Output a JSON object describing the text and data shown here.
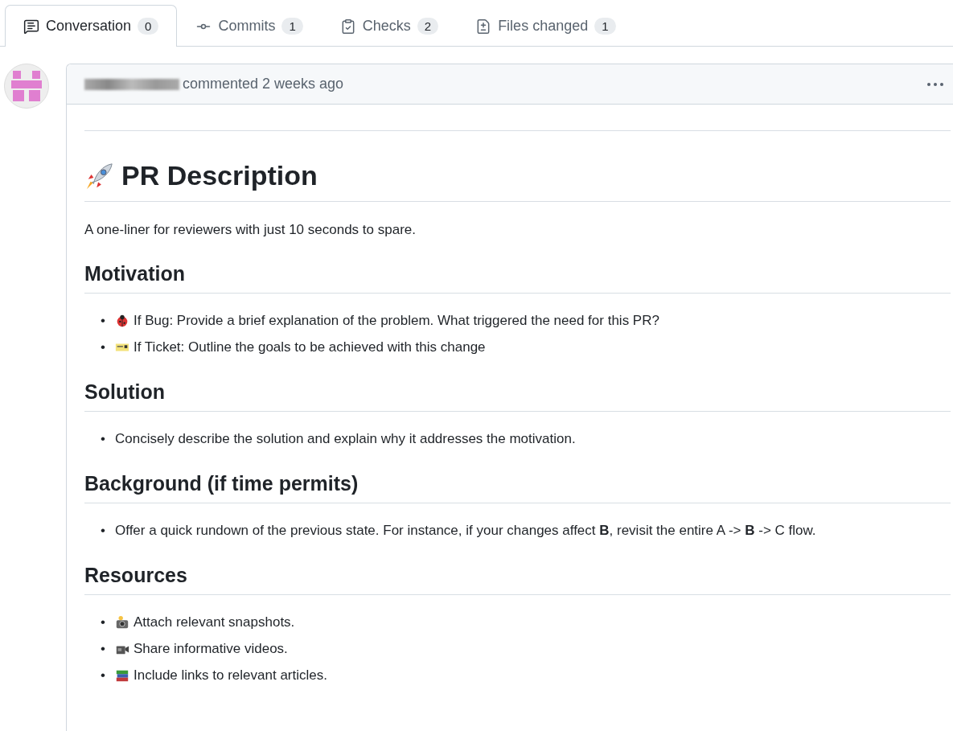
{
  "tabs": [
    {
      "label": "Conversation",
      "count": "0",
      "selected": true,
      "kind": "conversation"
    },
    {
      "label": "Commits",
      "count": "1",
      "selected": false,
      "kind": "commits"
    },
    {
      "label": "Checks",
      "count": "2",
      "selected": false,
      "kind": "checks"
    },
    {
      "label": "Files changed",
      "count": "1",
      "selected": false,
      "kind": "files"
    }
  ],
  "comment": {
    "action": "commented 2 weeks ago",
    "title": "PR Description",
    "summary": "A one-liner for reviewers with just 10 seconds to spare.",
    "sections": [
      {
        "heading": "Motivation",
        "items": [
          {
            "bullet": "•",
            "kind": "bug",
            "text": "If Bug: Provide a brief explanation of the problem. What triggered the need for this PR?"
          },
          {
            "bullet": "•",
            "kind": "ticket",
            "text": "If Ticket: Outline the goals to be achieved with this change"
          }
        ]
      },
      {
        "heading": "Solution",
        "items": [
          {
            "bullet": "•",
            "kind": "plain",
            "text": "Concisely describe the solution and explain why it addresses the motivation."
          }
        ]
      },
      {
        "heading": "Background (if time permits)",
        "items": [
          {
            "bullet": "•",
            "kind": "plain",
            "text": "Offer a quick rundown of the previous state. For instance, if your changes affect **B**, revisit the entire A -> **B** -> C flow."
          }
        ]
      },
      {
        "heading": "Resources",
        "items": [
          {
            "bullet": "•",
            "kind": "camera",
            "text": "Attach relevant snapshots."
          },
          {
            "bullet": "•",
            "kind": "video",
            "text": "Share informative videos."
          },
          {
            "bullet": "•",
            "kind": "books",
            "text": "Include links to relevant articles."
          }
        ]
      }
    ]
  }
}
